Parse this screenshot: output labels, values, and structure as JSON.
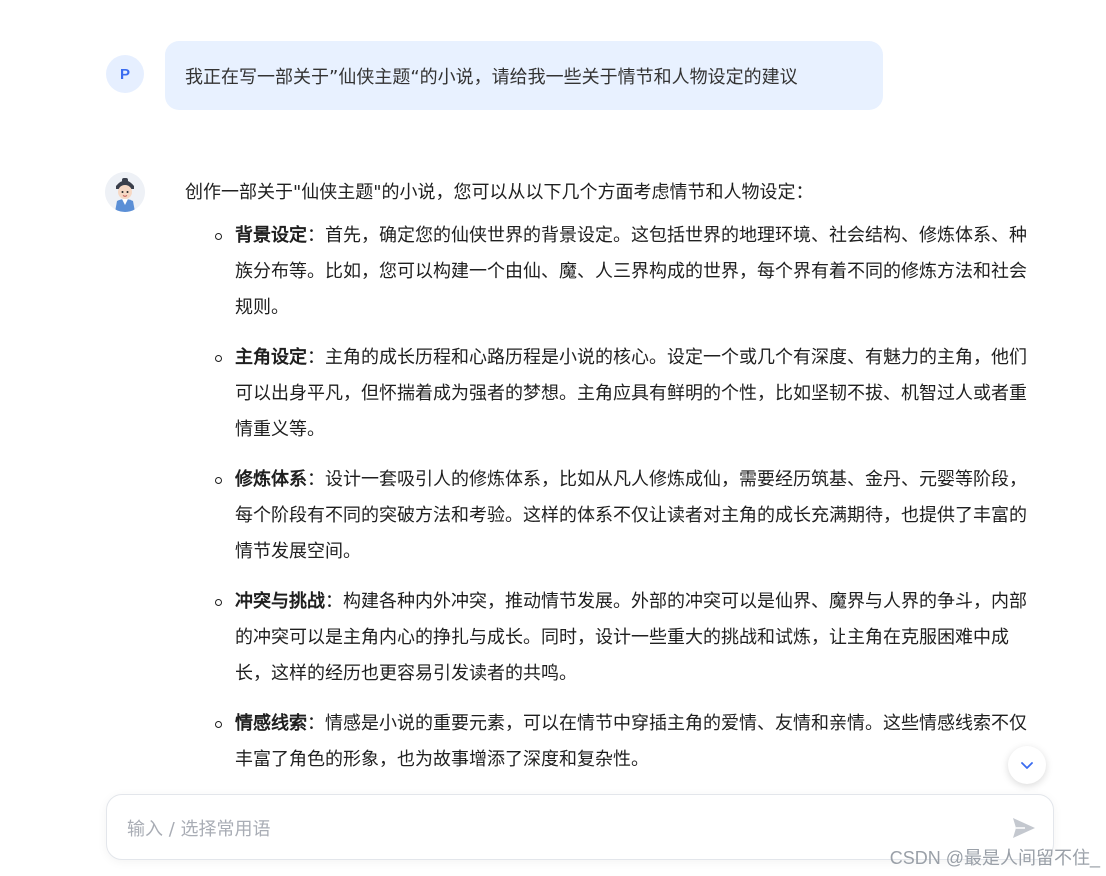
{
  "conversation": {
    "user_message": {
      "avatar_letter": "P",
      "text": "我正在写一部关于”仙侠主题“的小说，请给我一些关于情节和人物设定的建议"
    },
    "assistant_message": {
      "intro": "创作一部关于\"仙侠主题\"的小说，您可以从以下几个方面考虑情节和人物设定：",
      "points": [
        {
          "title": "背景设定",
          "text": "：首先，确定您的仙侠世界的背景设定。这包括世界的地理环境、社会结构、修炼体系、种族分布等。比如，您可以构建一个由仙、魔、人三界构成的世界，每个界有着不同的修炼方法和社会规则。"
        },
        {
          "title": "主角设定",
          "text": "：主角的成长历程和心路历程是小说的核心。设定一个或几个有深度、有魅力的主角，他们可以出身平凡，但怀揣着成为强者的梦想。主角应具有鲜明的个性，比如坚韧不拔、机智过人或者重情重义等。"
        },
        {
          "title": "修炼体系",
          "text": "：设计一套吸引人的修炼体系，比如从凡人修炼成仙，需要经历筑基、金丹、元婴等阶段，每个阶段有不同的突破方法和考验。这样的体系不仅让读者对主角的成长充满期待，也提供了丰富的情节发展空间。"
        },
        {
          "title": "冲突与挑战",
          "text": "：构建各种内外冲突，推动情节发展。外部的冲突可以是仙界、魔界与人界的争斗，内部的冲突可以是主角内心的挣扎与成长。同时，设计一些重大的挑战和试炼，让主角在克服困难中成长，这样的经历也更容易引发读者的共鸣。"
        },
        {
          "title": "情感线索",
          "text": "：情感是小说的重要元素，可以在情节中穿插主角的爱情、友情和亲情。这些情感线索不仅丰富了角色的形象，也为故事增添了深度和复杂性。"
        }
      ]
    }
  },
  "input": {
    "placeholder": "输入 / 选择常用语",
    "value": ""
  },
  "icons": {
    "scroll_down": "chevron-down-icon",
    "send": "send-icon",
    "assistant_avatar": "cartoon-avatar-icon"
  },
  "colors": {
    "user_bubble": "#e8f1ff",
    "user_avatar_text": "#3b6cf0",
    "chevron": "#3b6cf0",
    "send_icon": "#c4c8cf"
  },
  "watermark": "CSDN @最是人间留不住_"
}
